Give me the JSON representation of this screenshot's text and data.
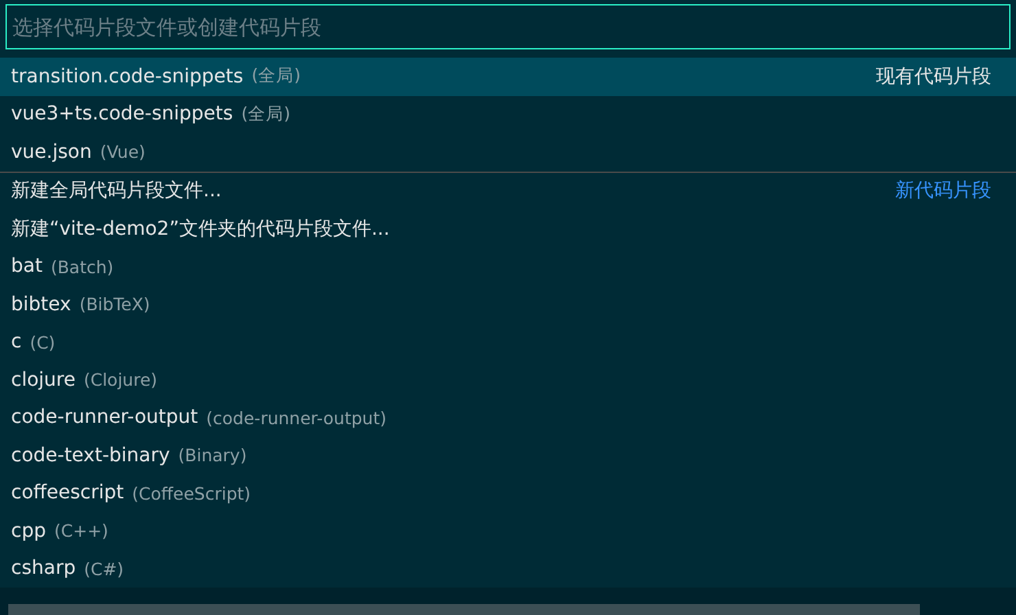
{
  "search": {
    "placeholder": "选择代码片段文件或创建代码片段"
  },
  "groups": [
    {
      "label": "现有代码片段",
      "items": [
        {
          "name": "transition.code-snippets",
          "description": "(全局)",
          "selected": true
        },
        {
          "name": "vue3+ts.code-snippets",
          "description": "(全局)",
          "selected": false
        },
        {
          "name": "vue.json",
          "description": "(Vue)",
          "selected": false
        }
      ]
    },
    {
      "label": "新代码片段",
      "items": [
        {
          "name": "新建全局代码片段文件...",
          "selected": false
        },
        {
          "name": "新建“vite-demo2”文件夹的代码片段文件...",
          "selected": false
        },
        {
          "name": "bat",
          "description": "(Batch)",
          "selected": false
        },
        {
          "name": "bibtex",
          "description": "(BibTeX)",
          "selected": false
        },
        {
          "name": "c",
          "description": "(C)",
          "selected": false
        },
        {
          "name": "clojure",
          "description": "(Clojure)",
          "selected": false
        },
        {
          "name": "code-runner-output",
          "description": "(code-runner-output)",
          "selected": false
        },
        {
          "name": "code-text-binary",
          "description": "(Binary)",
          "selected": false
        },
        {
          "name": "coffeescript",
          "description": "(CoffeeScript)",
          "selected": false
        },
        {
          "name": "cpp",
          "description": "(C++)",
          "selected": false
        },
        {
          "name": "csharp",
          "description": "(C#)",
          "selected": false
        }
      ]
    }
  ]
}
